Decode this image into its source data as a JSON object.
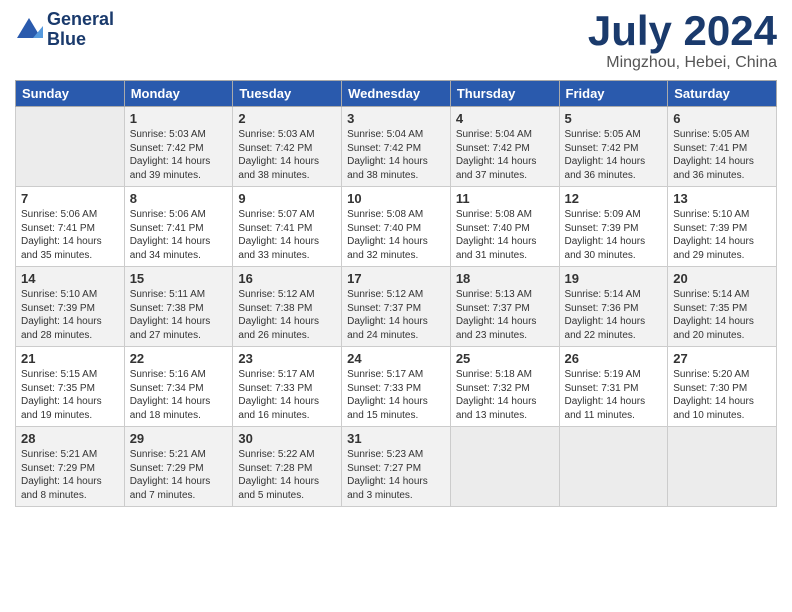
{
  "header": {
    "logo_line1": "General",
    "logo_line2": "Blue",
    "month_title": "July 2024",
    "location": "Mingzhou, Hebei, China"
  },
  "weekdays": [
    "Sunday",
    "Monday",
    "Tuesday",
    "Wednesday",
    "Thursday",
    "Friday",
    "Saturday"
  ],
  "weeks": [
    [
      {
        "day": "",
        "text": ""
      },
      {
        "day": "1",
        "text": "Sunrise: 5:03 AM\nSunset: 7:42 PM\nDaylight: 14 hours\nand 39 minutes."
      },
      {
        "day": "2",
        "text": "Sunrise: 5:03 AM\nSunset: 7:42 PM\nDaylight: 14 hours\nand 38 minutes."
      },
      {
        "day": "3",
        "text": "Sunrise: 5:04 AM\nSunset: 7:42 PM\nDaylight: 14 hours\nand 38 minutes."
      },
      {
        "day": "4",
        "text": "Sunrise: 5:04 AM\nSunset: 7:42 PM\nDaylight: 14 hours\nand 37 minutes."
      },
      {
        "day": "5",
        "text": "Sunrise: 5:05 AM\nSunset: 7:42 PM\nDaylight: 14 hours\nand 36 minutes."
      },
      {
        "day": "6",
        "text": "Sunrise: 5:05 AM\nSunset: 7:41 PM\nDaylight: 14 hours\nand 36 minutes."
      }
    ],
    [
      {
        "day": "7",
        "text": "Sunrise: 5:06 AM\nSunset: 7:41 PM\nDaylight: 14 hours\nand 35 minutes."
      },
      {
        "day": "8",
        "text": "Sunrise: 5:06 AM\nSunset: 7:41 PM\nDaylight: 14 hours\nand 34 minutes."
      },
      {
        "day": "9",
        "text": "Sunrise: 5:07 AM\nSunset: 7:41 PM\nDaylight: 14 hours\nand 33 minutes."
      },
      {
        "day": "10",
        "text": "Sunrise: 5:08 AM\nSunset: 7:40 PM\nDaylight: 14 hours\nand 32 minutes."
      },
      {
        "day": "11",
        "text": "Sunrise: 5:08 AM\nSunset: 7:40 PM\nDaylight: 14 hours\nand 31 minutes."
      },
      {
        "day": "12",
        "text": "Sunrise: 5:09 AM\nSunset: 7:39 PM\nDaylight: 14 hours\nand 30 minutes."
      },
      {
        "day": "13",
        "text": "Sunrise: 5:10 AM\nSunset: 7:39 PM\nDaylight: 14 hours\nand 29 minutes."
      }
    ],
    [
      {
        "day": "14",
        "text": "Sunrise: 5:10 AM\nSunset: 7:39 PM\nDaylight: 14 hours\nand 28 minutes."
      },
      {
        "day": "15",
        "text": "Sunrise: 5:11 AM\nSunset: 7:38 PM\nDaylight: 14 hours\nand 27 minutes."
      },
      {
        "day": "16",
        "text": "Sunrise: 5:12 AM\nSunset: 7:38 PM\nDaylight: 14 hours\nand 26 minutes."
      },
      {
        "day": "17",
        "text": "Sunrise: 5:12 AM\nSunset: 7:37 PM\nDaylight: 14 hours\nand 24 minutes."
      },
      {
        "day": "18",
        "text": "Sunrise: 5:13 AM\nSunset: 7:37 PM\nDaylight: 14 hours\nand 23 minutes."
      },
      {
        "day": "19",
        "text": "Sunrise: 5:14 AM\nSunset: 7:36 PM\nDaylight: 14 hours\nand 22 minutes."
      },
      {
        "day": "20",
        "text": "Sunrise: 5:14 AM\nSunset: 7:35 PM\nDaylight: 14 hours\nand 20 minutes."
      }
    ],
    [
      {
        "day": "21",
        "text": "Sunrise: 5:15 AM\nSunset: 7:35 PM\nDaylight: 14 hours\nand 19 minutes."
      },
      {
        "day": "22",
        "text": "Sunrise: 5:16 AM\nSunset: 7:34 PM\nDaylight: 14 hours\nand 18 minutes."
      },
      {
        "day": "23",
        "text": "Sunrise: 5:17 AM\nSunset: 7:33 PM\nDaylight: 14 hours\nand 16 minutes."
      },
      {
        "day": "24",
        "text": "Sunrise: 5:17 AM\nSunset: 7:33 PM\nDaylight: 14 hours\nand 15 minutes."
      },
      {
        "day": "25",
        "text": "Sunrise: 5:18 AM\nSunset: 7:32 PM\nDaylight: 14 hours\nand 13 minutes."
      },
      {
        "day": "26",
        "text": "Sunrise: 5:19 AM\nSunset: 7:31 PM\nDaylight: 14 hours\nand 11 minutes."
      },
      {
        "day": "27",
        "text": "Sunrise: 5:20 AM\nSunset: 7:30 PM\nDaylight: 14 hours\nand 10 minutes."
      }
    ],
    [
      {
        "day": "28",
        "text": "Sunrise: 5:21 AM\nSunset: 7:29 PM\nDaylight: 14 hours\nand 8 minutes."
      },
      {
        "day": "29",
        "text": "Sunrise: 5:21 AM\nSunset: 7:29 PM\nDaylight: 14 hours\nand 7 minutes."
      },
      {
        "day": "30",
        "text": "Sunrise: 5:22 AM\nSunset: 7:28 PM\nDaylight: 14 hours\nand 5 minutes."
      },
      {
        "day": "31",
        "text": "Sunrise: 5:23 AM\nSunset: 7:27 PM\nDaylight: 14 hours\nand 3 minutes."
      },
      {
        "day": "",
        "text": ""
      },
      {
        "day": "",
        "text": ""
      },
      {
        "day": "",
        "text": ""
      }
    ]
  ]
}
